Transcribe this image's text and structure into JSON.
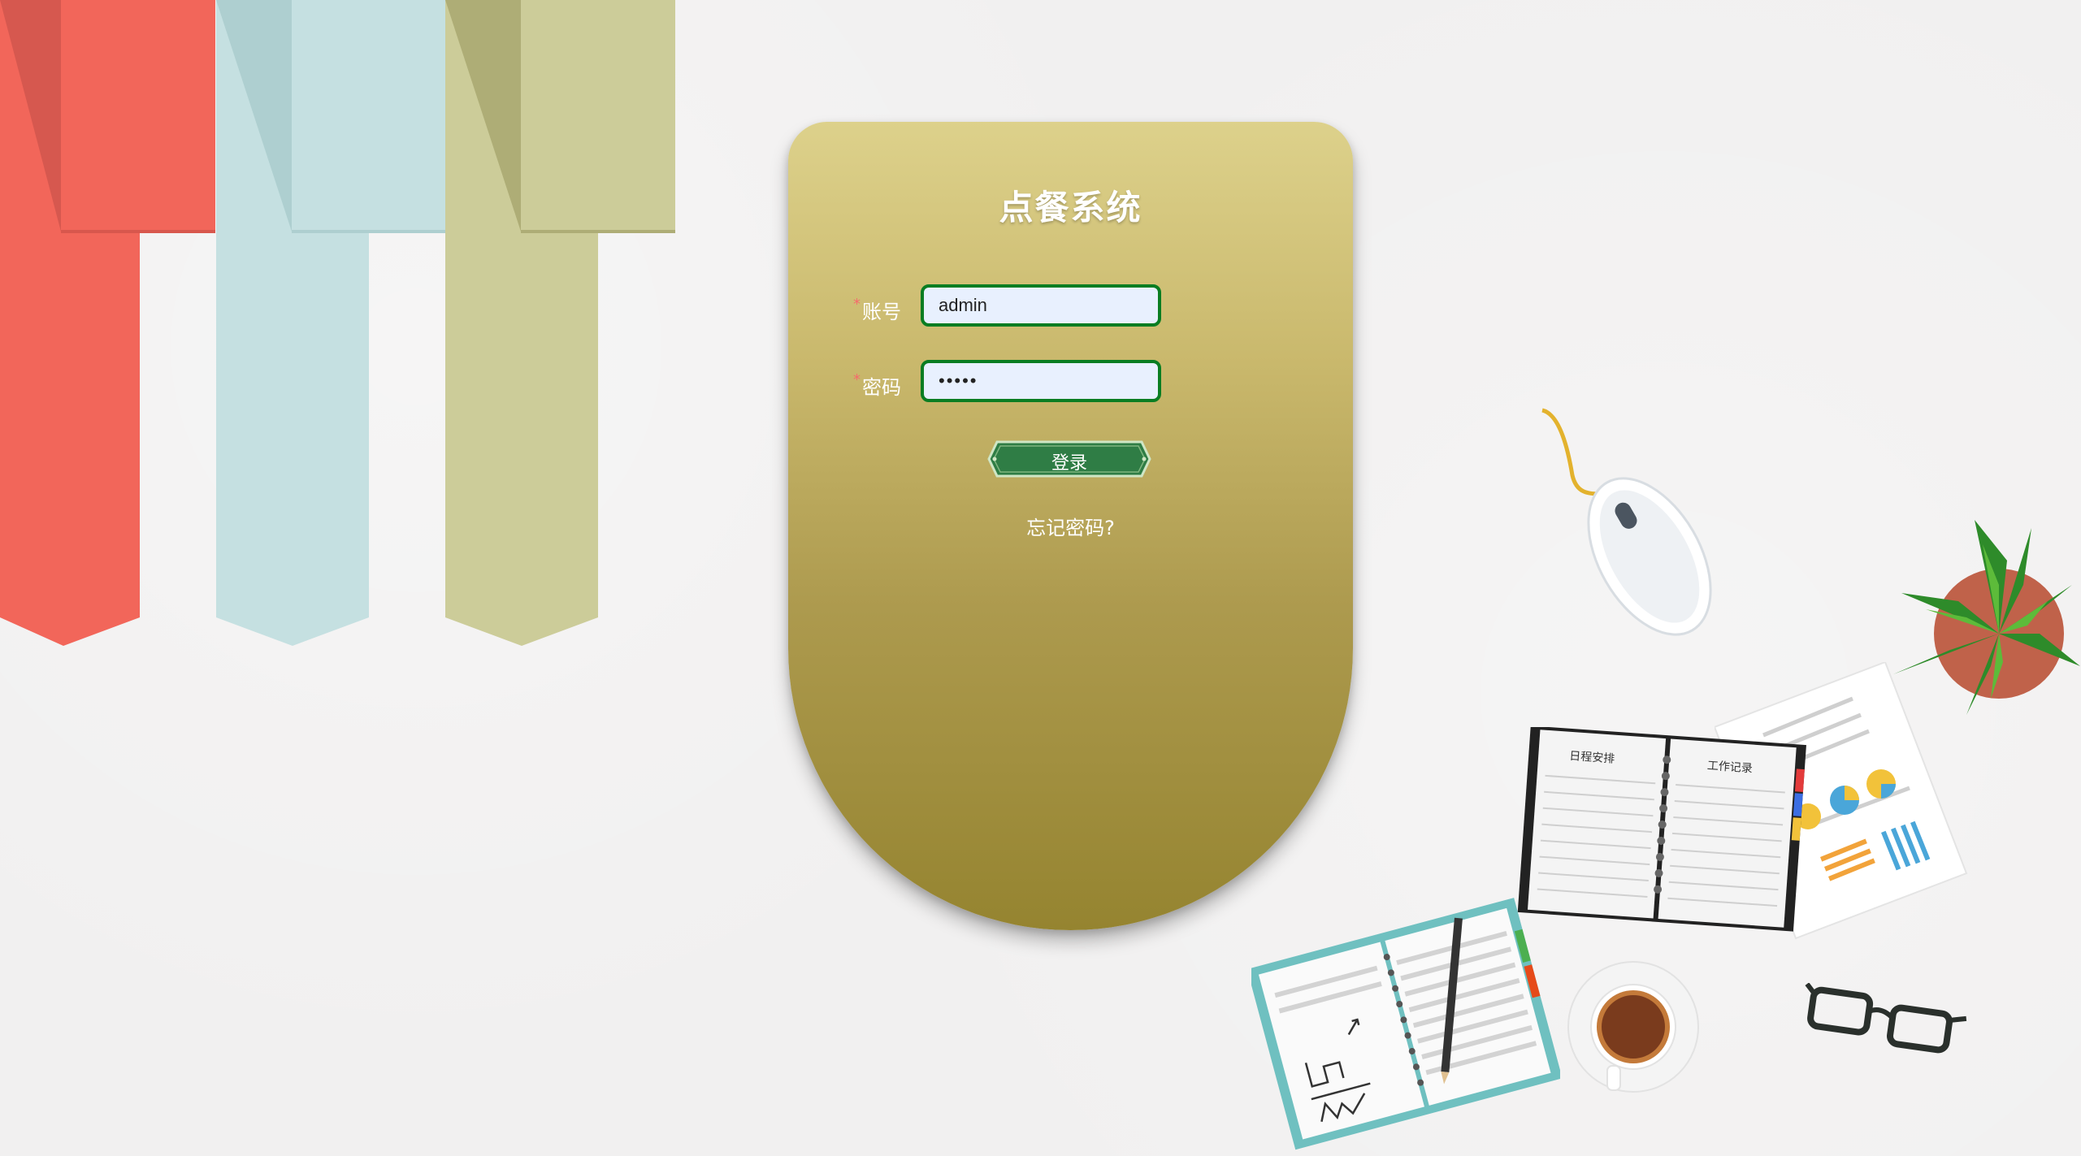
{
  "app": {
    "title": "点餐系统"
  },
  "login_form": {
    "username_label": "账号",
    "username_value": "admin",
    "password_label": "密码",
    "password_value": "•••••",
    "required_mark": "*",
    "submit_label": "登录",
    "forgot_link": "忘记密码?"
  },
  "colors": {
    "card_top": "#ddd18b",
    "card_bottom": "#958430",
    "input_border": "#0a7d22",
    "input_bg": "#e8f0fe",
    "button_green": "#2f7d45",
    "ribbon_red": "#f2665a",
    "ribbon_blue": "#c5e0e1",
    "ribbon_olive": "#cccc99"
  },
  "desk_decor": {
    "notebook_left_heading": "日程安排",
    "notebook_right_heading": "工作记录"
  }
}
